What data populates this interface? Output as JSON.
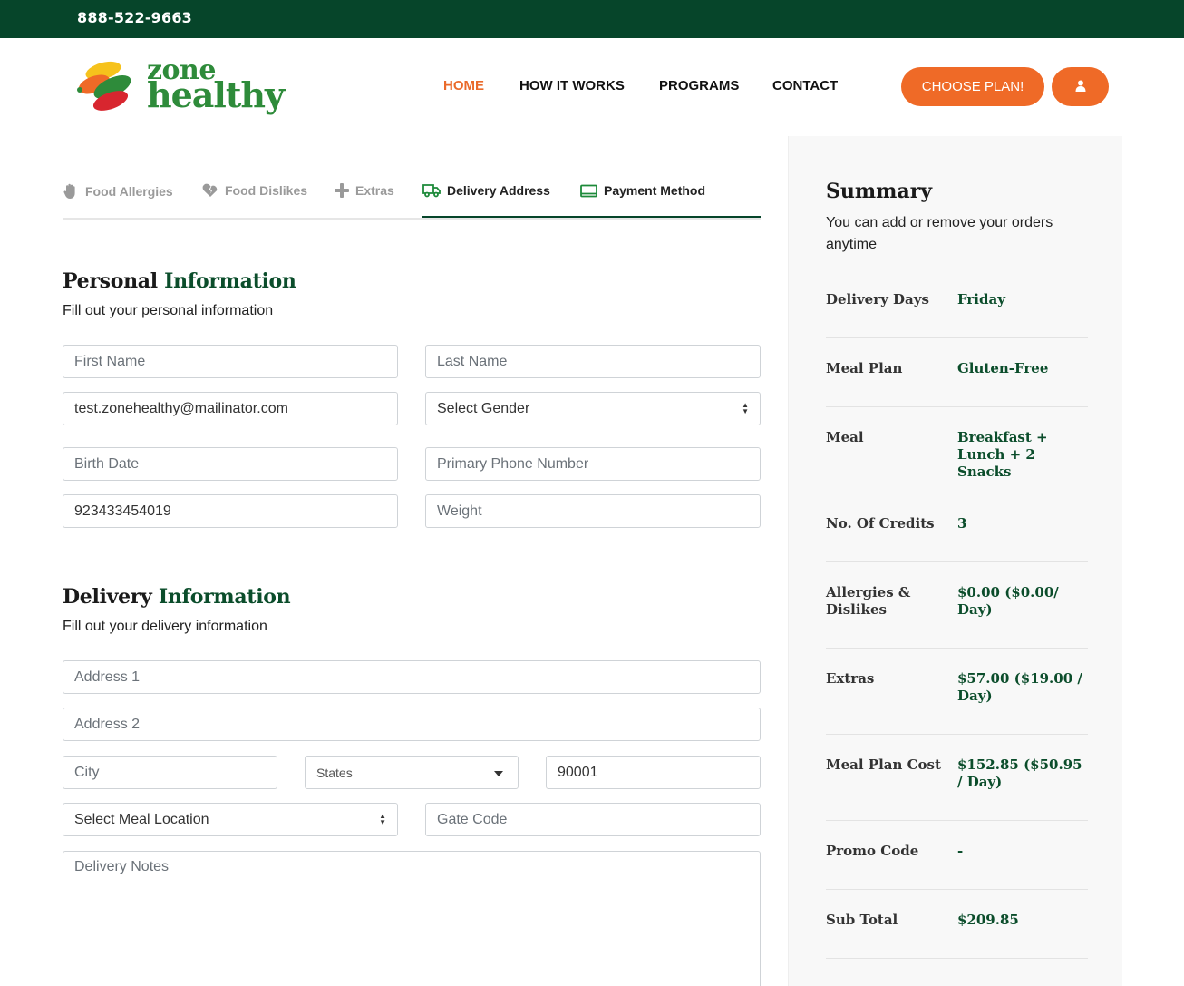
{
  "topbar": {
    "phone": "888-522-9663"
  },
  "brand": {
    "line1": "zone",
    "line2": "healthy"
  },
  "nav": [
    {
      "label": "HOME",
      "active": true
    },
    {
      "label": "HOW IT WORKS"
    },
    {
      "label": "PROGRAMS"
    },
    {
      "label": "CONTACT"
    }
  ],
  "header": {
    "choose_plan": "CHOOSE PLAN!"
  },
  "steps": [
    {
      "label": "Food Allergies",
      "icon": "hand-icon"
    },
    {
      "label": "Food Dislikes",
      "icon": "broken-heart-icon"
    },
    {
      "label": "Extras",
      "icon": "plus-icon"
    },
    {
      "label": "Delivery Address",
      "icon": "truck-icon",
      "active": true
    },
    {
      "label": "Payment Method",
      "icon": "card-icon"
    }
  ],
  "personal": {
    "title_a": "Personal",
    "title_b": "Information",
    "subtitle": "Fill out your personal information",
    "first_name": {
      "placeholder": "First Name",
      "value": ""
    },
    "last_name": {
      "placeholder": "Last Name",
      "value": ""
    },
    "email": {
      "value": "test.zonehealthy@mailinator.com"
    },
    "gender": {
      "selected": "Select Gender"
    },
    "birth_date": {
      "placeholder": "Birth Date"
    },
    "phone": {
      "placeholder": "Primary Phone Number"
    },
    "alt_phone": {
      "value": "923433454019"
    },
    "weight": {
      "placeholder": "Weight"
    }
  },
  "delivery": {
    "title_a": "Delivery",
    "title_b": "Information",
    "subtitle": "Fill out your delivery information",
    "address1": {
      "placeholder": "Address 1"
    },
    "address2": {
      "placeholder": "Address 2"
    },
    "city": {
      "placeholder": "City"
    },
    "state": {
      "selected": "States"
    },
    "zip": {
      "value": "90001"
    },
    "meal_location": {
      "selected": "Select Meal Location"
    },
    "gate_code": {
      "placeholder": "Gate Code"
    },
    "notes": {
      "placeholder": "Delivery Notes"
    }
  },
  "summary": {
    "title": "Summary",
    "intro": "You can add or remove your orders anytime",
    "rows": [
      {
        "label": "Delivery Days",
        "value": "Friday"
      },
      {
        "label": "Meal Plan",
        "value": "Gluten-Free"
      },
      {
        "label": "Meal",
        "value": "Breakfast + Lunch + 2 Snacks"
      },
      {
        "label": "No. Of Credits",
        "value": "3"
      },
      {
        "label": "Allergies & Dislikes",
        "value": "$0.00 ($0.00/ Day)"
      },
      {
        "label": "Extras",
        "value": "$57.00 ($19.00 / Day)"
      },
      {
        "label": "Meal Plan Cost",
        "value": "$152.85 ($50.95 / Day)"
      },
      {
        "label": "Promo Code",
        "value": "-"
      },
      {
        "label": "Sub Total",
        "value": "$209.85"
      }
    ]
  },
  "colors": {
    "brand_green": "#06452a",
    "accent_orange": "#ef6a27",
    "logo_green": "#2e8b3a"
  }
}
